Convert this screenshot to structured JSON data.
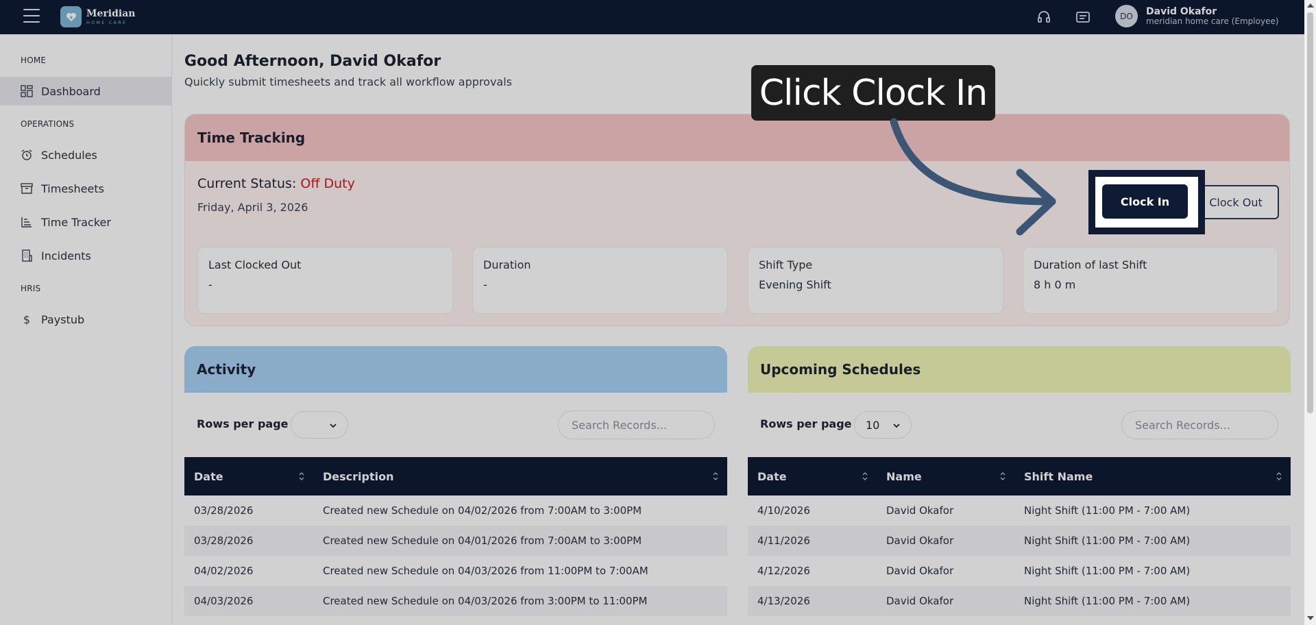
{
  "app": {
    "brand_name": "Meridian",
    "brand_sub": "HOME CARE",
    "user": {
      "initials": "DO",
      "name": "David Okafor",
      "org": "meridian home care (Employee)"
    }
  },
  "sidebar": {
    "sections": [
      {
        "label": "HOME",
        "items": [
          {
            "label": "Dashboard",
            "icon": "grid-icon",
            "active": true
          }
        ]
      },
      {
        "label": "OPERATIONS",
        "items": [
          {
            "label": "Schedules",
            "icon": "alarm-clock-icon"
          },
          {
            "label": "Timesheets",
            "icon": "archive-box-icon"
          },
          {
            "label": "Time Tracker",
            "icon": "list-tree-icon"
          },
          {
            "label": "Incidents",
            "icon": "building-icon"
          }
        ]
      },
      {
        "label": "HRIS",
        "items": [
          {
            "label": "Paystub",
            "icon": "dollar-icon"
          }
        ]
      }
    ]
  },
  "header": {
    "greeting": "Good Afternoon, David Okafor",
    "subtitle": "Quickly submit timesheets and track all workflow approvals"
  },
  "time_tracking": {
    "title": "Time Tracking",
    "status_label": "Current Status:",
    "status_value": "Off Duty",
    "date": "Friday, April 3, 2026",
    "clock_in": "Clock In",
    "clock_out": "Clock Out",
    "stats": [
      {
        "label": "Last Clocked Out",
        "value": "-"
      },
      {
        "label": "Duration",
        "value": "-"
      },
      {
        "label": "Shift Type",
        "value": "Evening Shift"
      },
      {
        "label": "Duration of last Shift",
        "value": "8 h 0 m"
      }
    ]
  },
  "activity": {
    "title": "Activity",
    "rows_per_page_label": "Rows per page",
    "rows_per_page_value": "",
    "search_placeholder": "Search Records...",
    "columns": [
      "Date",
      "Description"
    ],
    "rows": [
      [
        "03/28/2026",
        "Created new Schedule on 04/02/2026 from 7:00AM to 3:00PM"
      ],
      [
        "03/28/2026",
        "Created new Schedule on 04/01/2026 from 7:00AM to 3:00PM"
      ],
      [
        "04/02/2026",
        "Created new Schedule on 04/03/2026 from 11:00PM to 7:00AM"
      ],
      [
        "04/03/2026",
        "Created new Schedule on 04/03/2026 from 3:00PM to 11:00PM"
      ]
    ]
  },
  "upcoming": {
    "title": "Upcoming Schedules",
    "rows_per_page_label": "Rows per page",
    "rows_per_page_value": "10",
    "search_placeholder": "Search Records...",
    "columns": [
      "Date",
      "Name",
      "Shift Name"
    ],
    "rows": [
      [
        "4/10/2026",
        "David Okafor",
        "Night Shift (11:00 PM - 7:00 AM)"
      ],
      [
        "4/11/2026",
        "David Okafor",
        "Night Shift (11:00 PM - 7:00 AM)"
      ],
      [
        "4/12/2026",
        "David Okafor",
        "Night Shift (11:00 PM - 7:00 AM)"
      ],
      [
        "4/13/2026",
        "David Okafor",
        "Night Shift (11:00 PM - 7:00 AM)"
      ]
    ]
  },
  "tutorial": {
    "tooltip": "Click Clock In"
  },
  "colors": {
    "navy": "#0f1b35",
    "off_duty": "#d01a1a",
    "tracking_header": "#f7c8c8",
    "activity_header": "#a8d4f6",
    "upcoming_header": "#f0f6b8"
  }
}
